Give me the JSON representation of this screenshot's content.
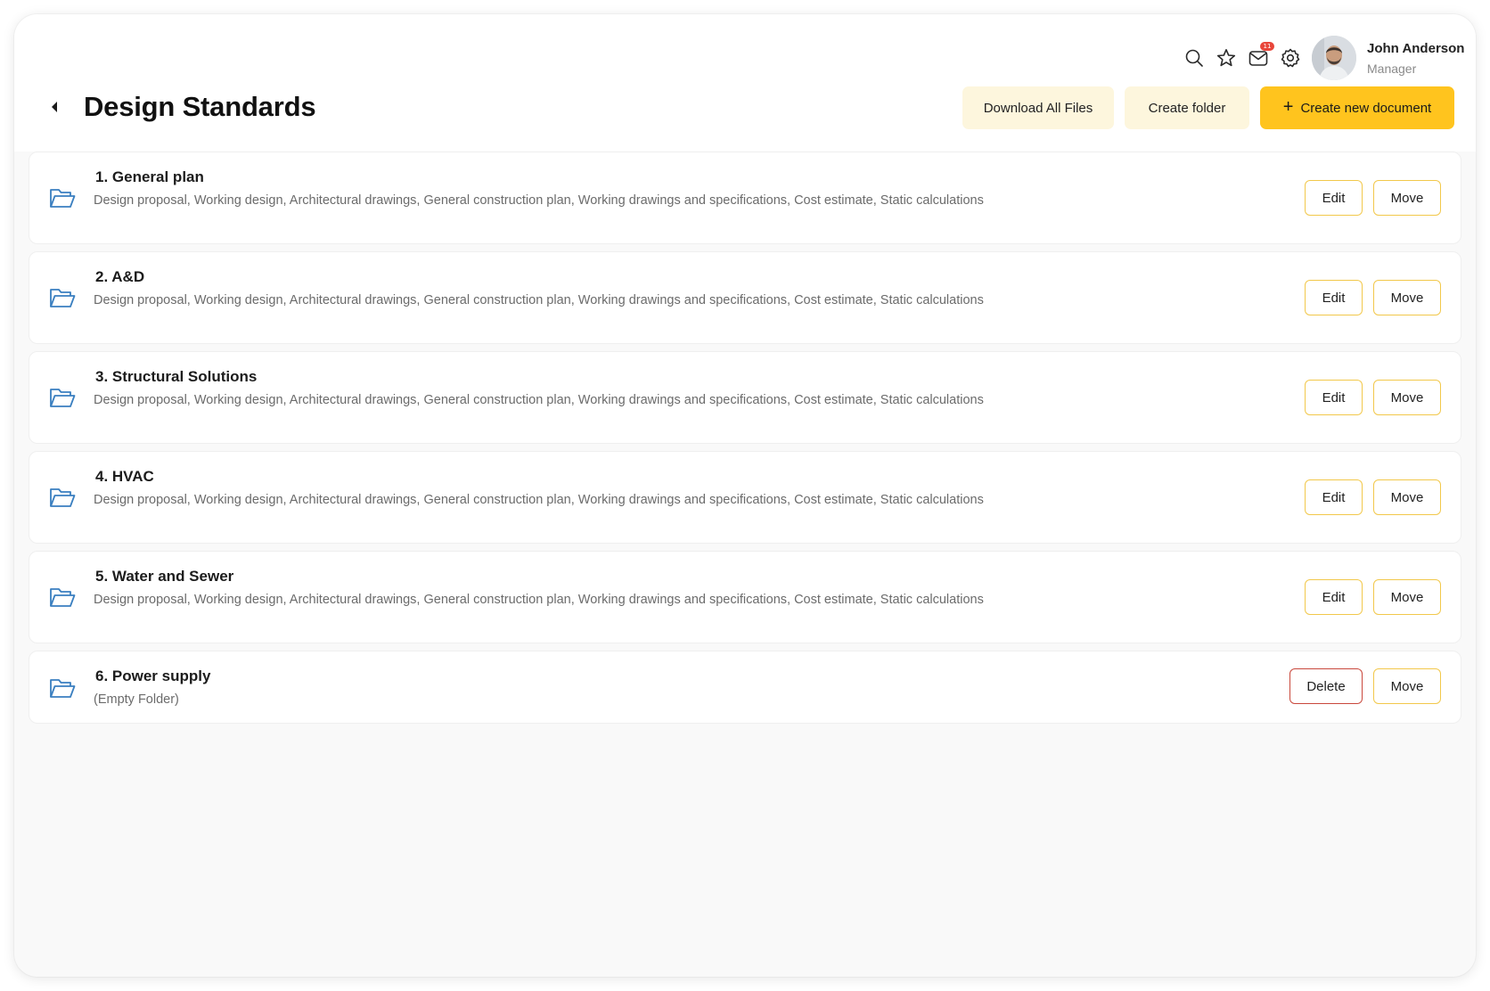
{
  "header": {
    "notification_count": "11",
    "user": {
      "name": "John Anderson",
      "role": "Manager"
    }
  },
  "page": {
    "title": "Design Standards",
    "download_all_label": "Download All Files",
    "create_folder_label": "Create folder",
    "create_document_plus": "+",
    "create_document_label": "Create new document"
  },
  "folders": [
    {
      "title": "1. General plan",
      "desc": "Design proposal, Working design, Architectural drawings, General construction plan, Working drawings and specifications, Cost estimate, Static calculations",
      "edit_label": "Edit",
      "move_label": "Move"
    },
    {
      "title": "2. A&D",
      "desc": "Design proposal, Working design, Architectural drawings, General construction plan, Working drawings and specifications, Cost estimate, Static calculations",
      "edit_label": "Edit",
      "move_label": "Move"
    },
    {
      "title": "3. Structural Solutions",
      "desc": "Design proposal, Working design, Architectural drawings, General construction plan, Working drawings and specifications, Cost estimate, Static calculations",
      "edit_label": "Edit",
      "move_label": "Move"
    },
    {
      "title": "4. HVAC",
      "desc": "Design proposal, Working design, Architectural drawings, General construction plan, Working drawings and specifications, Cost estimate, Static calculations",
      "edit_label": "Edit",
      "move_label": "Move"
    },
    {
      "title": "5. Water and Sewer",
      "desc": "Design proposal, Working design, Architectural drawings, General construction plan, Working drawings and specifications, Cost estimate, Static calculations",
      "edit_label": "Edit",
      "move_label": "Move"
    },
    {
      "title": "6. Power supply",
      "desc": "(Empty Folder)",
      "delete_label": "Delete",
      "move_label": "Move"
    }
  ],
  "colors": {
    "accent": "#ffc41e",
    "soft_button": "#fdf6dd",
    "outline": "#f2c84b",
    "danger": "#c9483c",
    "folder_icon": "#3a7fc0",
    "badge": "#e8463a"
  },
  "icons": [
    "search-icon",
    "star-icon",
    "mail-icon",
    "gear-icon",
    "back-arrow-icon",
    "folder-open-icon",
    "plus-icon"
  ]
}
